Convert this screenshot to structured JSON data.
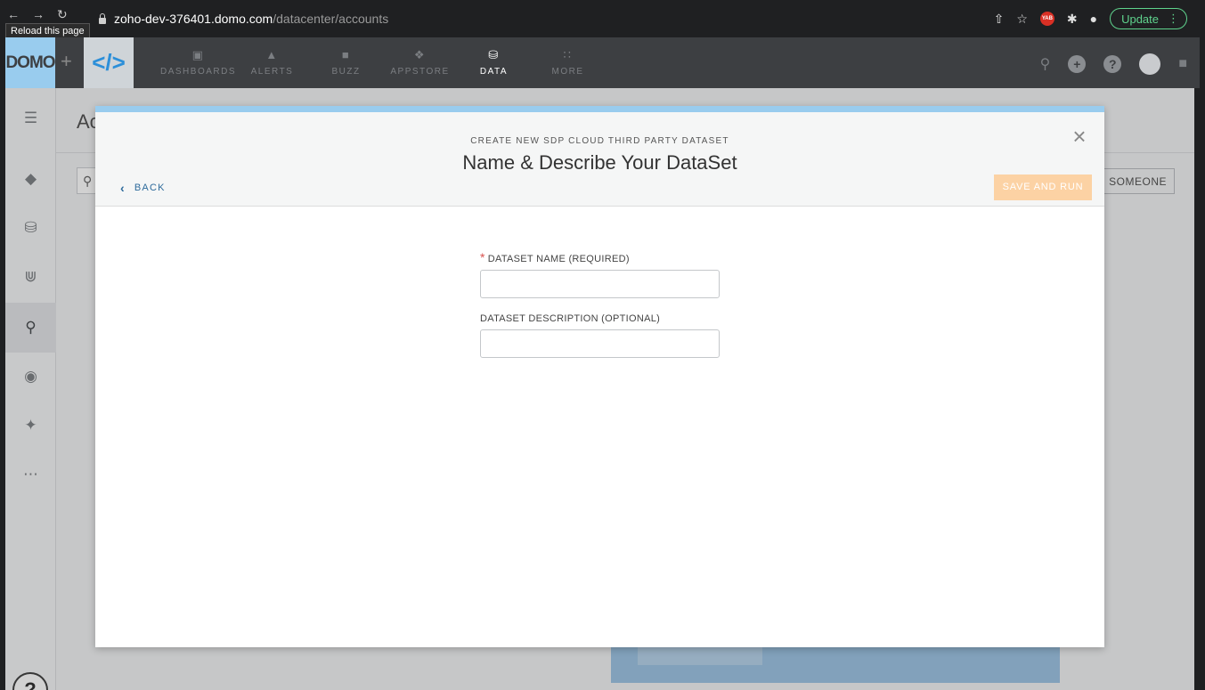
{
  "browser": {
    "tooltip": "Reload this page",
    "url_host": "zoho-dev-376401.domo.com",
    "url_path": "/datacenter/accounts",
    "update_label": "Update",
    "ext_badge": "YAB"
  },
  "appbar": {
    "logo": "DOMO",
    "nav": [
      {
        "label": "DASHBOARDS",
        "icon": "dashboard-icon"
      },
      {
        "label": "ALERTS",
        "icon": "bell-icon"
      },
      {
        "label": "BUZZ",
        "icon": "chat-icon"
      },
      {
        "label": "APPSTORE",
        "icon": "appstore-icon"
      },
      {
        "label": "DATA",
        "icon": "database-icon"
      },
      {
        "label": "MORE",
        "icon": "grid-icon"
      }
    ]
  },
  "background": {
    "page_title": "Ac",
    "share_label": "N SOMEONE"
  },
  "modal": {
    "subtitle": "CREATE NEW SDP CLOUD THIRD PARTY DATASET",
    "title": "Name & Describe Your DataSet",
    "back_label": "BACK",
    "save_label": "SAVE AND RUN",
    "name_label": "DATASET NAME (REQUIRED)",
    "name_value": "",
    "desc_label": "DATASET DESCRIPTION (OPTIONAL)",
    "desc_value": ""
  },
  "colors": {
    "accent": "#99ccee",
    "link": "#2e6b9c",
    "save_disabled": "#fcd2a4",
    "required": "#d9534f"
  }
}
